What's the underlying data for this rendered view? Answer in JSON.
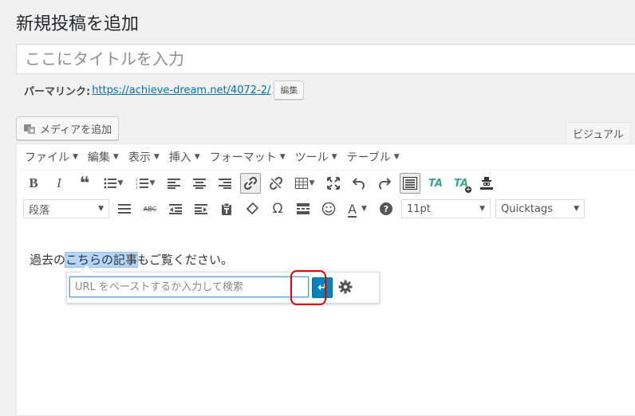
{
  "page": {
    "title": "新規投稿を追加"
  },
  "title_field": {
    "placeholder": "ここにタイトルを入力"
  },
  "permalink": {
    "label": "パーマリンク:",
    "url": "https://achieve-dream.net/4072-2/",
    "edit_label": "編集"
  },
  "media": {
    "add_label": "メディアを追加"
  },
  "editor_tabs": {
    "visual_label": "ビジュアル"
  },
  "menubar": {
    "items": [
      "ファイル",
      "編集",
      "表示",
      "挿入",
      "フォーマット",
      "ツール",
      "テーブル"
    ]
  },
  "toolbar1": {
    "bold": "B",
    "italic": "I",
    "quote": "❝",
    "icons": [
      "bold-icon",
      "italic-icon",
      "blockquote-icon",
      "bullet-list-icon",
      "numbered-list-icon",
      "align-left-icon",
      "align-center-icon",
      "align-right-icon",
      "link-icon",
      "unlink-icon",
      "table-icon",
      "fullscreen-icon",
      "undo-icon",
      "redo-icon",
      "toolbar-toggle-icon",
      "ta-icon",
      "ta-plus-icon",
      "stamp-icon"
    ],
    "ta_label": "TA"
  },
  "toolbar2": {
    "format_select": "段落",
    "size_select": "11pt",
    "quicktags_select": "Quicktags",
    "omega": "Ω",
    "strike": "ABC",
    "text_color": "A",
    "help": "?"
  },
  "content": {
    "before": "過去の",
    "selected": "こちらの記事",
    "after": "もご覧ください。"
  },
  "link_popup": {
    "placeholder": "URL をペーストするか入力して検索",
    "apply_symbol": "↵",
    "accent": "#0085ba"
  },
  "colors": {
    "highlight_ring": "#e30000",
    "link": "#0073aa"
  }
}
